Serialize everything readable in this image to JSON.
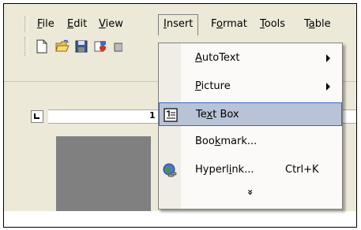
{
  "menubar": {
    "items": [
      {
        "label": "File",
        "ul": "F",
        "rest": "ile"
      },
      {
        "label": "Edit",
        "ul": "E",
        "rest": "dit"
      },
      {
        "label": "View",
        "ul": "V",
        "rest": "iew"
      },
      {
        "label": "Insert",
        "ul": "I",
        "rest": "nsert"
      },
      {
        "label": "Format",
        "pre": "F",
        "ul": "o",
        "rest": "rmat"
      },
      {
        "label": "Tools",
        "ul": "T",
        "rest": "ools"
      },
      {
        "label": "Table",
        "pre": "T",
        "ul": "a",
        "rest": "ble"
      }
    ]
  },
  "toolbar": {
    "icons": [
      "new-document-icon",
      "open-folder-icon",
      "save-icon",
      "permission-icon",
      "print-icon"
    ]
  },
  "ruler": {
    "number": "1"
  },
  "insert_menu": {
    "items": [
      {
        "pre": "",
        "ul": "A",
        "rest": "utoText",
        "shortcut": "",
        "submenu": true
      },
      {
        "pre": "",
        "ul": "P",
        "rest": "icture",
        "shortcut": "",
        "submenu": true
      },
      {
        "pre": "Te",
        "ul": "x",
        "rest": "t Box",
        "shortcut": "",
        "submenu": false,
        "icon": "text-box-icon",
        "highlighted": true
      },
      {
        "pre": "Boo",
        "ul": "k",
        "rest": "mark...",
        "shortcut": "",
        "submenu": false
      },
      {
        "pre": "Hyperl",
        "ul": "i",
        "rest": "nk...",
        "shortcut": "Ctrl+K",
        "submenu": false,
        "icon": "hyperlink-globe-icon"
      }
    ],
    "expand_glyph": "»"
  },
  "colors": {
    "chrome": "#ece9d8",
    "highlight_fill": "#b9c3d7",
    "highlight_border": "#316ac5",
    "doc_gray": "#808080"
  }
}
